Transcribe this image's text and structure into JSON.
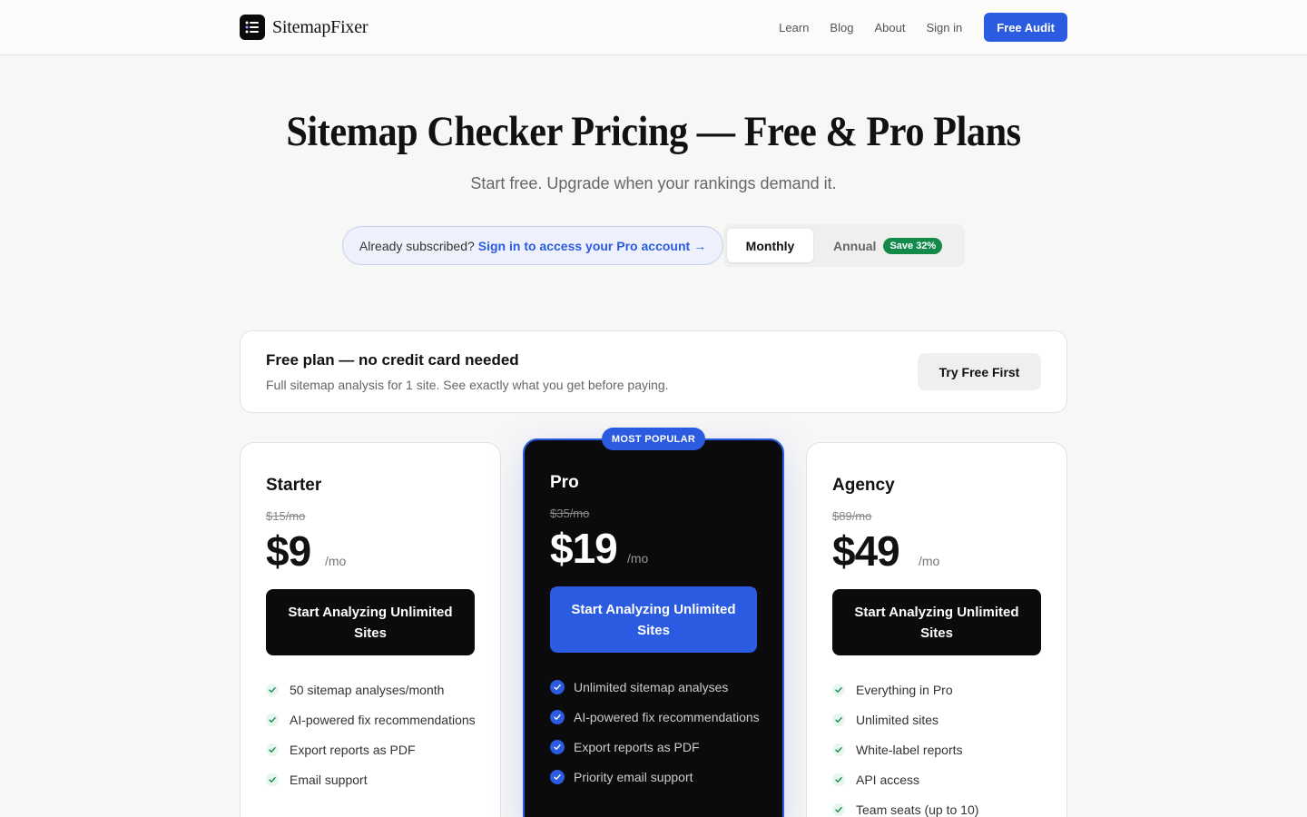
{
  "nav": {
    "brand": "SitemapFixer",
    "links": [
      "Learn",
      "Blog",
      "About",
      "Sign in"
    ],
    "cta": "Free Audit"
  },
  "hero": {
    "title": "Sitemap Checker Pricing — Free & Pro Plans",
    "subtitle": "Start free. Upgrade when your rankings demand it."
  },
  "subscribed": {
    "text": "Already subscribed?",
    "link": "Sign in to access your Pro account →"
  },
  "billing_toggle": {
    "monthly": "Monthly",
    "annual": "Annual",
    "save_badge": "Save 32%",
    "selected": "Monthly"
  },
  "free_plan": {
    "title": "Free plan — no credit card needed",
    "description": "Full sitemap analysis for 1 site. See exactly what you get before paying.",
    "button": "Try Free First"
  },
  "plans": [
    {
      "name": "Starter",
      "old_price": "$15/mo",
      "price": "$9",
      "per": "/mo",
      "button": "Start Analyzing Unlimited Sites",
      "features": [
        "50 sitemap analyses/month",
        "AI-powered fix recommendations",
        "Export reports as PDF",
        "Email support"
      ]
    },
    {
      "name": "Pro",
      "badge": "MOST POPULAR",
      "old_price": "$35/mo",
      "price": "$19",
      "per": "/mo",
      "button": "Start Analyzing Unlimited Sites",
      "features": [
        "Unlimited sitemap analyses",
        "AI-powered fix recommendations",
        "Export reports as PDF",
        "Priority email support"
      ]
    },
    {
      "name": "Agency",
      "old_price": "$89/mo",
      "price": "$49",
      "per": "/mo",
      "button": "Start Analyzing Unlimited Sites",
      "features": [
        "Everything in Pro",
        "Unlimited sites",
        "White-label reports",
        "API access",
        "Team seats (up to 10)"
      ]
    }
  ],
  "colors": {
    "accent": "#2b5be0",
    "dark": "#0b0b0d",
    "success": "#138a4a",
    "background": "#f7f7f6"
  }
}
